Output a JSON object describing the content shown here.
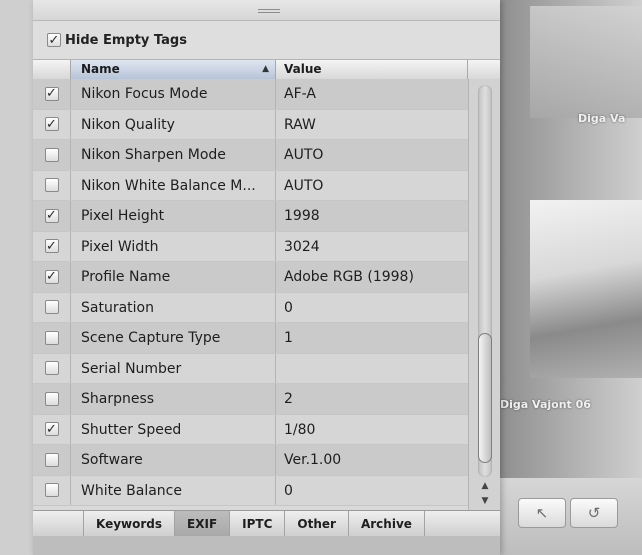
{
  "filter": {
    "label": "Hide Empty Tags",
    "checked": true
  },
  "table": {
    "columns": {
      "name": "Name",
      "value": "Value"
    },
    "rows": [
      {
        "checked": true,
        "name": "Nikon Focus Mode",
        "value": "AF-A"
      },
      {
        "checked": true,
        "name": "Nikon Quality",
        "value": "RAW"
      },
      {
        "checked": false,
        "name": "Nikon Sharpen Mode",
        "value": "AUTO"
      },
      {
        "checked": false,
        "name": "Nikon White Balance M...",
        "value": "AUTO"
      },
      {
        "checked": true,
        "name": "Pixel Height",
        "value": "1998"
      },
      {
        "checked": true,
        "name": "Pixel Width",
        "value": "3024"
      },
      {
        "checked": true,
        "name": "Profile Name",
        "value": "Adobe RGB (1998)"
      },
      {
        "checked": false,
        "name": "Saturation",
        "value": "0"
      },
      {
        "checked": false,
        "name": "Scene Capture Type",
        "value": "1"
      },
      {
        "checked": false,
        "name": "Serial Number",
        "value": ""
      },
      {
        "checked": false,
        "name": "Sharpness",
        "value": "2"
      },
      {
        "checked": true,
        "name": "Shutter Speed",
        "value": "1/80"
      },
      {
        "checked": false,
        "name": "Software",
        "value": "Ver.1.00"
      },
      {
        "checked": false,
        "name": "White Balance",
        "value": "0"
      }
    ]
  },
  "tabs": [
    {
      "label": "Keywords",
      "active": false
    },
    {
      "label": "EXIF",
      "active": true
    },
    {
      "label": "IPTC",
      "active": false
    },
    {
      "label": "Other",
      "active": false
    },
    {
      "label": "Archive",
      "active": false
    }
  ],
  "browser": {
    "captions": [
      "Diga Va",
      "Diga Vajont 06"
    ]
  },
  "icons": {
    "check": "checkmark-icon",
    "sort": "sort-ascending-icon",
    "pointer": "arrow-pointer-icon",
    "rotate": "rotate-icon"
  }
}
